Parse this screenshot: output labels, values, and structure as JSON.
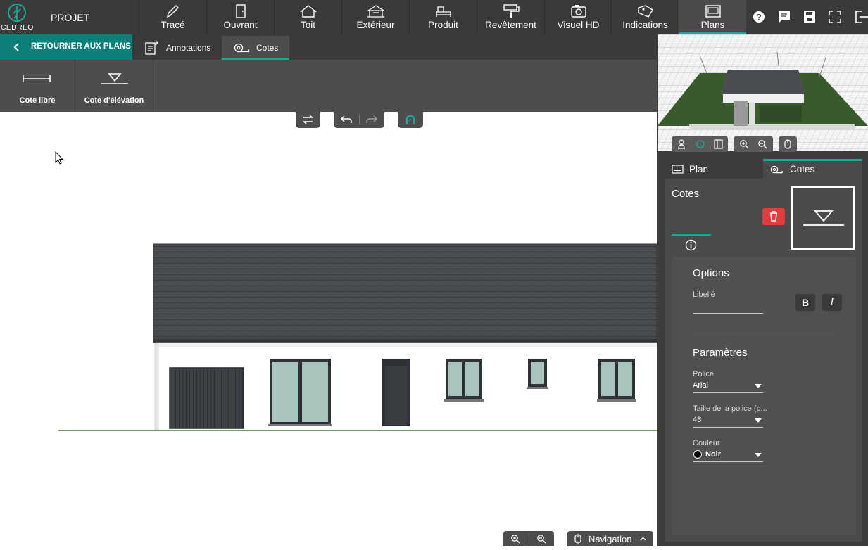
{
  "app": {
    "logo_text": "CEDREO",
    "project_label": "PROJET"
  },
  "nav": {
    "tabs": [
      {
        "label": "Tracé",
        "icon": "pencil-icon"
      },
      {
        "label": "Ouvrant",
        "icon": "door-icon"
      },
      {
        "label": "Toit",
        "icon": "roof-icon"
      },
      {
        "label": "Extérieur",
        "icon": "gazebo-icon"
      },
      {
        "label": "Produit",
        "icon": "furniture-icon"
      },
      {
        "label": "Revêtement",
        "icon": "paint-roller-icon"
      },
      {
        "label": "Visuel HD",
        "icon": "camera-icon"
      },
      {
        "label": "Indications",
        "icon": "tag-icon"
      },
      {
        "label": "Plans",
        "icon": "plans-icon"
      }
    ],
    "active": "Plans"
  },
  "subnav": {
    "back_label": "RETOURNER AUX PLANS",
    "tabs": [
      {
        "label": "Annotations",
        "icon": "annotations-icon"
      },
      {
        "label": "Cotes",
        "icon": "measure-tape-icon"
      }
    ],
    "active": "Cotes"
  },
  "tools": [
    {
      "label": "Cote libre",
      "icon": "free-dimension-icon"
    },
    {
      "label": "Cote d'élévation",
      "icon": "elevation-dimension-icon"
    }
  ],
  "right_panel": {
    "tabs": [
      {
        "label": "Plan",
        "icon": "plan-icon"
      },
      {
        "label": "Cotes",
        "icon": "measure-tape-icon"
      }
    ],
    "active_tab": "Cotes",
    "section_title": "Cotes",
    "options_title": "Options",
    "libelle_label": "Libellé",
    "libelle_value": "",
    "bold_label": "B",
    "italic_label": "I",
    "params_title": "Paramètres",
    "police_label": "Police",
    "police_value": "Arial",
    "taille_label": "Taille de la police (p...",
    "taille_value": "48",
    "couleur_label": "Couleur",
    "couleur_value": "Noir",
    "couleur_swatch": "#000000"
  },
  "bottom": {
    "navigation_label": "Navigation"
  },
  "colors": {
    "accent": "#1aa89b",
    "back_button": "#0e7e78",
    "delete": "#e03e3e",
    "toolbar": "#3a3a3a"
  }
}
